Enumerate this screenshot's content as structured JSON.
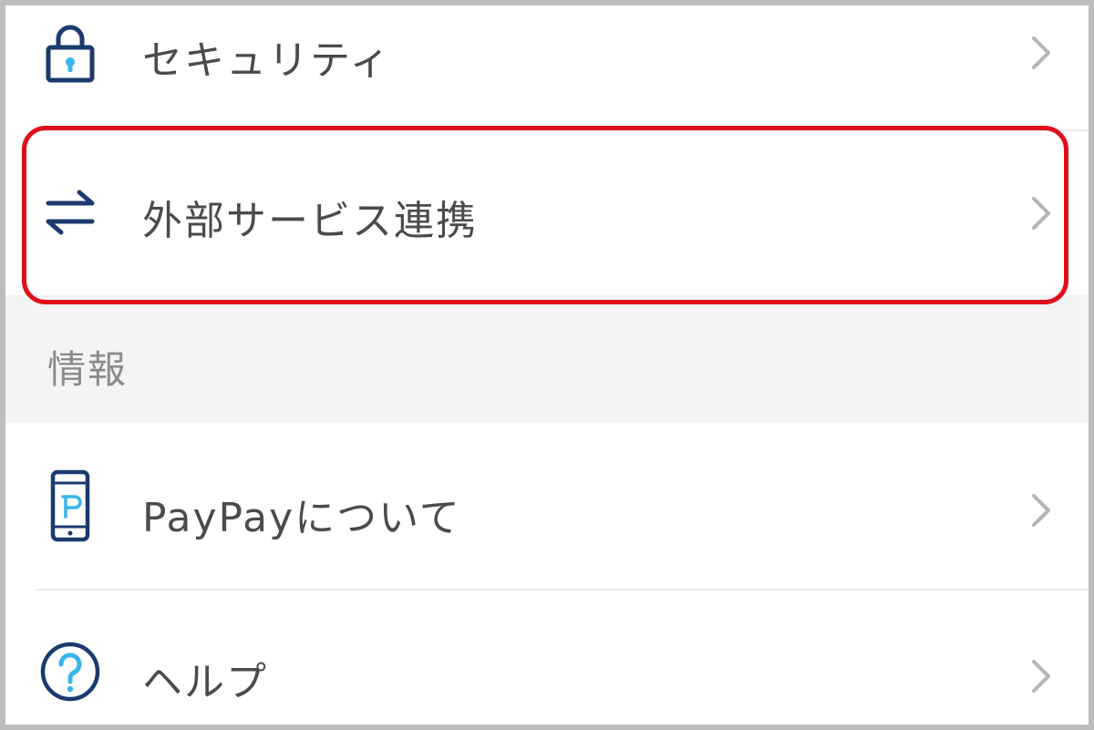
{
  "colors": {
    "highlight": "#e0101b",
    "icon_navy": "#1b3a6e",
    "icon_accent": "#3ab4ea",
    "label_text": "#4b4b4b",
    "section_text": "#8b8b8b",
    "chevron": "#b5b5b5"
  },
  "menu": {
    "security": {
      "label": "セキュリティ",
      "icon": "lock-icon"
    },
    "external_services": {
      "label": "外部サービス連携",
      "icon": "swap-arrows-icon",
      "highlighted": true
    }
  },
  "info_section": {
    "title": "情報",
    "items": [
      {
        "label": "PayPayについて",
        "icon": "phone-paypay-icon"
      },
      {
        "label": "ヘルプ",
        "icon": "help-icon"
      }
    ]
  }
}
